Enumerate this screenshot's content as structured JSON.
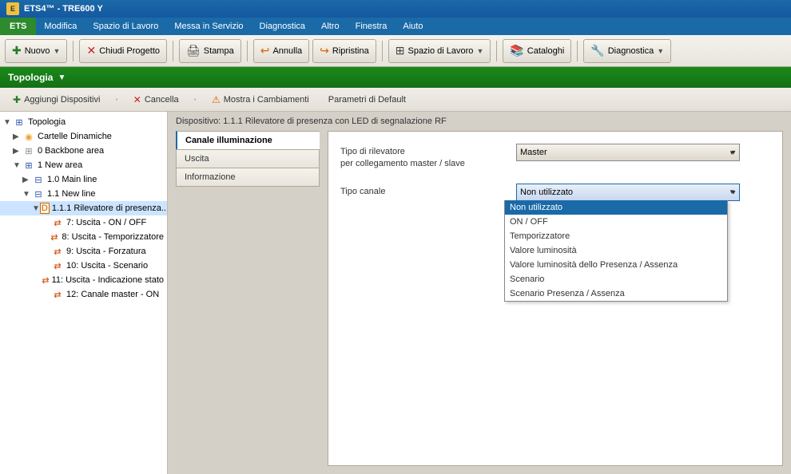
{
  "title_bar": {
    "icon": "ETS4",
    "title": " ETS4™ - TRE600 Y"
  },
  "menu_bar": {
    "ets": "ETS",
    "items": [
      "Modifica",
      "Spazio di Lavoro",
      "Messa in Servizio",
      "Diagnostica",
      "Altro",
      "Finestra",
      "Aiuto"
    ]
  },
  "toolbar": {
    "nuovo": "Nuovo",
    "chiudi_progetto": "Chiudi Progetto",
    "stampa": "Stampa",
    "annulla": "Annulla",
    "ripristina": "Ripristina",
    "spazio_di_lavoro": "Spazio di Lavoro",
    "cataloghi": "Cataloghi",
    "diagnostica": "Diagnostica"
  },
  "topologia_bar": {
    "label": "Topologia"
  },
  "action_bar": {
    "aggiungi": "Aggiungi Dispositivi",
    "cancella": "Cancella",
    "mostra": "Mostra i Cambiamenti",
    "parametri": "Parametri di Default"
  },
  "tree": {
    "items": [
      {
        "label": "Topologia",
        "level": 0,
        "expanded": true,
        "icon": "topology"
      },
      {
        "label": "Cartelle Dinamiche",
        "level": 1,
        "expanded": false,
        "icon": "folder"
      },
      {
        "label": "0 Backbone area",
        "level": 1,
        "expanded": false,
        "icon": "backbone"
      },
      {
        "label": "1 New area",
        "level": 1,
        "expanded": true,
        "icon": "area"
      },
      {
        "label": "1.0 Main line",
        "level": 2,
        "expanded": false,
        "icon": "line"
      },
      {
        "label": "1.1 New line",
        "level": 2,
        "expanded": true,
        "icon": "line"
      },
      {
        "label": "1.1.1  Rilevatore di presenza...",
        "level": 3,
        "expanded": true,
        "icon": "device",
        "selected": true
      },
      {
        "label": "7: Uscita - ON / OFF",
        "level": 4,
        "icon": "channel"
      },
      {
        "label": "8: Uscita - Temporizzatore",
        "level": 4,
        "icon": "channel"
      },
      {
        "label": "9: Uscita - Forzatura",
        "level": 4,
        "icon": "channel"
      },
      {
        "label": "10: Uscita - Scenario",
        "level": 4,
        "icon": "channel"
      },
      {
        "label": "11: Uscita - Indicazione stato",
        "level": 4,
        "icon": "channel"
      },
      {
        "label": "12: Canale master - ON",
        "level": 4,
        "icon": "channel"
      }
    ]
  },
  "device_header": {
    "text": "Dispositivo: 1.1.1  Rilevatore di presenza con LED di segnalazione RF"
  },
  "tabs": [
    {
      "label": "Canale illuminazione",
      "active": true
    },
    {
      "label": "Uscita",
      "active": false
    },
    {
      "label": "Informazione",
      "active": false
    }
  ],
  "form": {
    "tipo_rilevatore_label": "Tipo di rilevatore\nper collegamento master / slave",
    "tipo_rilevatore_value": "Master",
    "tipo_canale_label": "Tipo canale",
    "tipo_canale_value": "Non utilizzato",
    "dropdown_options": [
      {
        "label": "Non utilizzato",
        "highlighted": true
      },
      {
        "label": "ON / OFF",
        "highlighted": false
      },
      {
        "label": "Temporizzatore",
        "highlighted": false
      },
      {
        "label": "Valore luminosità",
        "highlighted": false
      },
      {
        "label": "Valore luminosità dello  Presenza / Assenza",
        "highlighted": false
      },
      {
        "label": "Scenario",
        "highlighted": false
      },
      {
        "label": "Scenario Presenza / Assenza",
        "highlighted": false
      }
    ]
  }
}
